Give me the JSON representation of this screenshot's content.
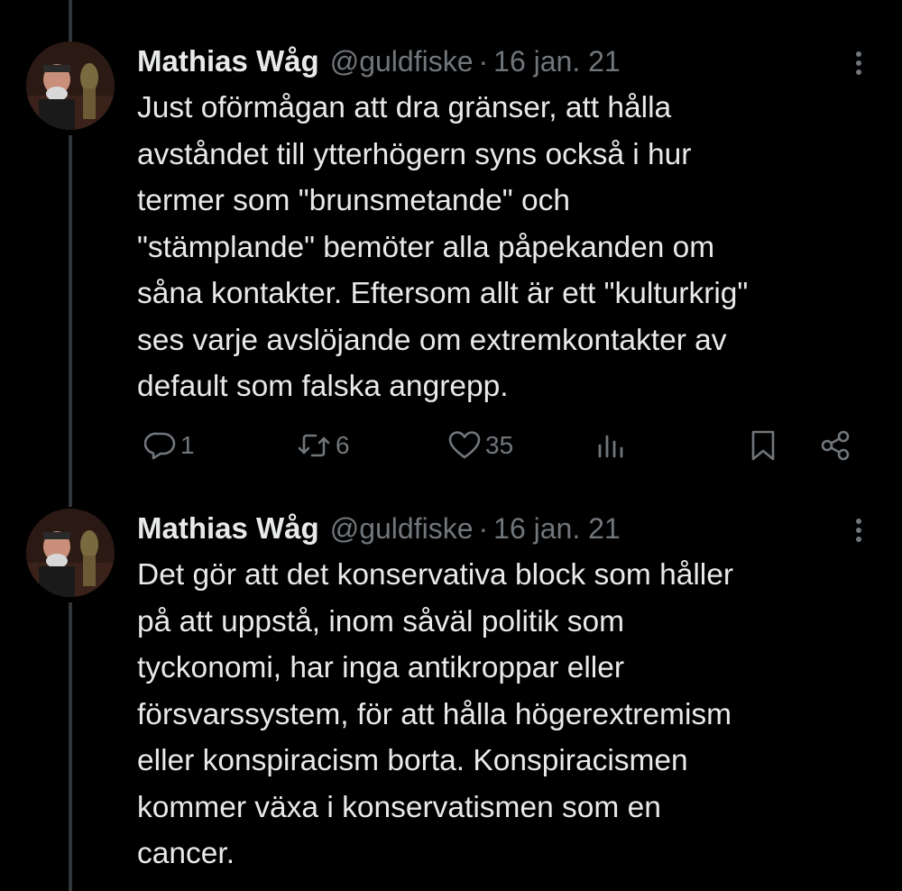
{
  "tweets": [
    {
      "author": "Mathias Wåg",
      "handle": "@guldfiske",
      "separator": "·",
      "date": "16 jan. 21",
      "lines": [
        "Just oförmågan att dra gränser, att hålla",
        "avståndet till ytterhögern syns också i hur",
        "termer som \"brunsmetande\" och",
        "\"stämplande\" bemöter alla påpekanden om",
        "såna kontakter. Eftersom allt är ett \"kulturkrig\"",
        "ses varje avslöjande om extremkontakter av",
        "default som falska angrepp."
      ],
      "actions": {
        "reply_count": "1",
        "retweet_count": "6",
        "like_count": "35"
      }
    },
    {
      "author": "Mathias Wåg",
      "handle": "@guldfiske",
      "separator": "·",
      "date": "16 jan. 21",
      "lines": [
        "Det gör att det konservativa block som håller",
        "på att uppstå, inom såväl politik som",
        "tyckonomi, har inga antikroppar eller",
        "försvarssystem, för att hålla högerextremism",
        "eller konspiracism borta. Konspiracismen",
        "kommer växa i konservatismen som en",
        "cancer."
      ]
    }
  ],
  "icons": {
    "reply": "reply-icon",
    "retweet": "retweet-icon",
    "like": "heart-icon",
    "views": "views-icon",
    "bookmark": "bookmark-icon",
    "share": "share-icon",
    "more": "more-icon"
  },
  "colors": {
    "background": "#000000",
    "text": "#e7e9ea",
    "secondary": "#71767b",
    "thread_line": "#333639"
  }
}
